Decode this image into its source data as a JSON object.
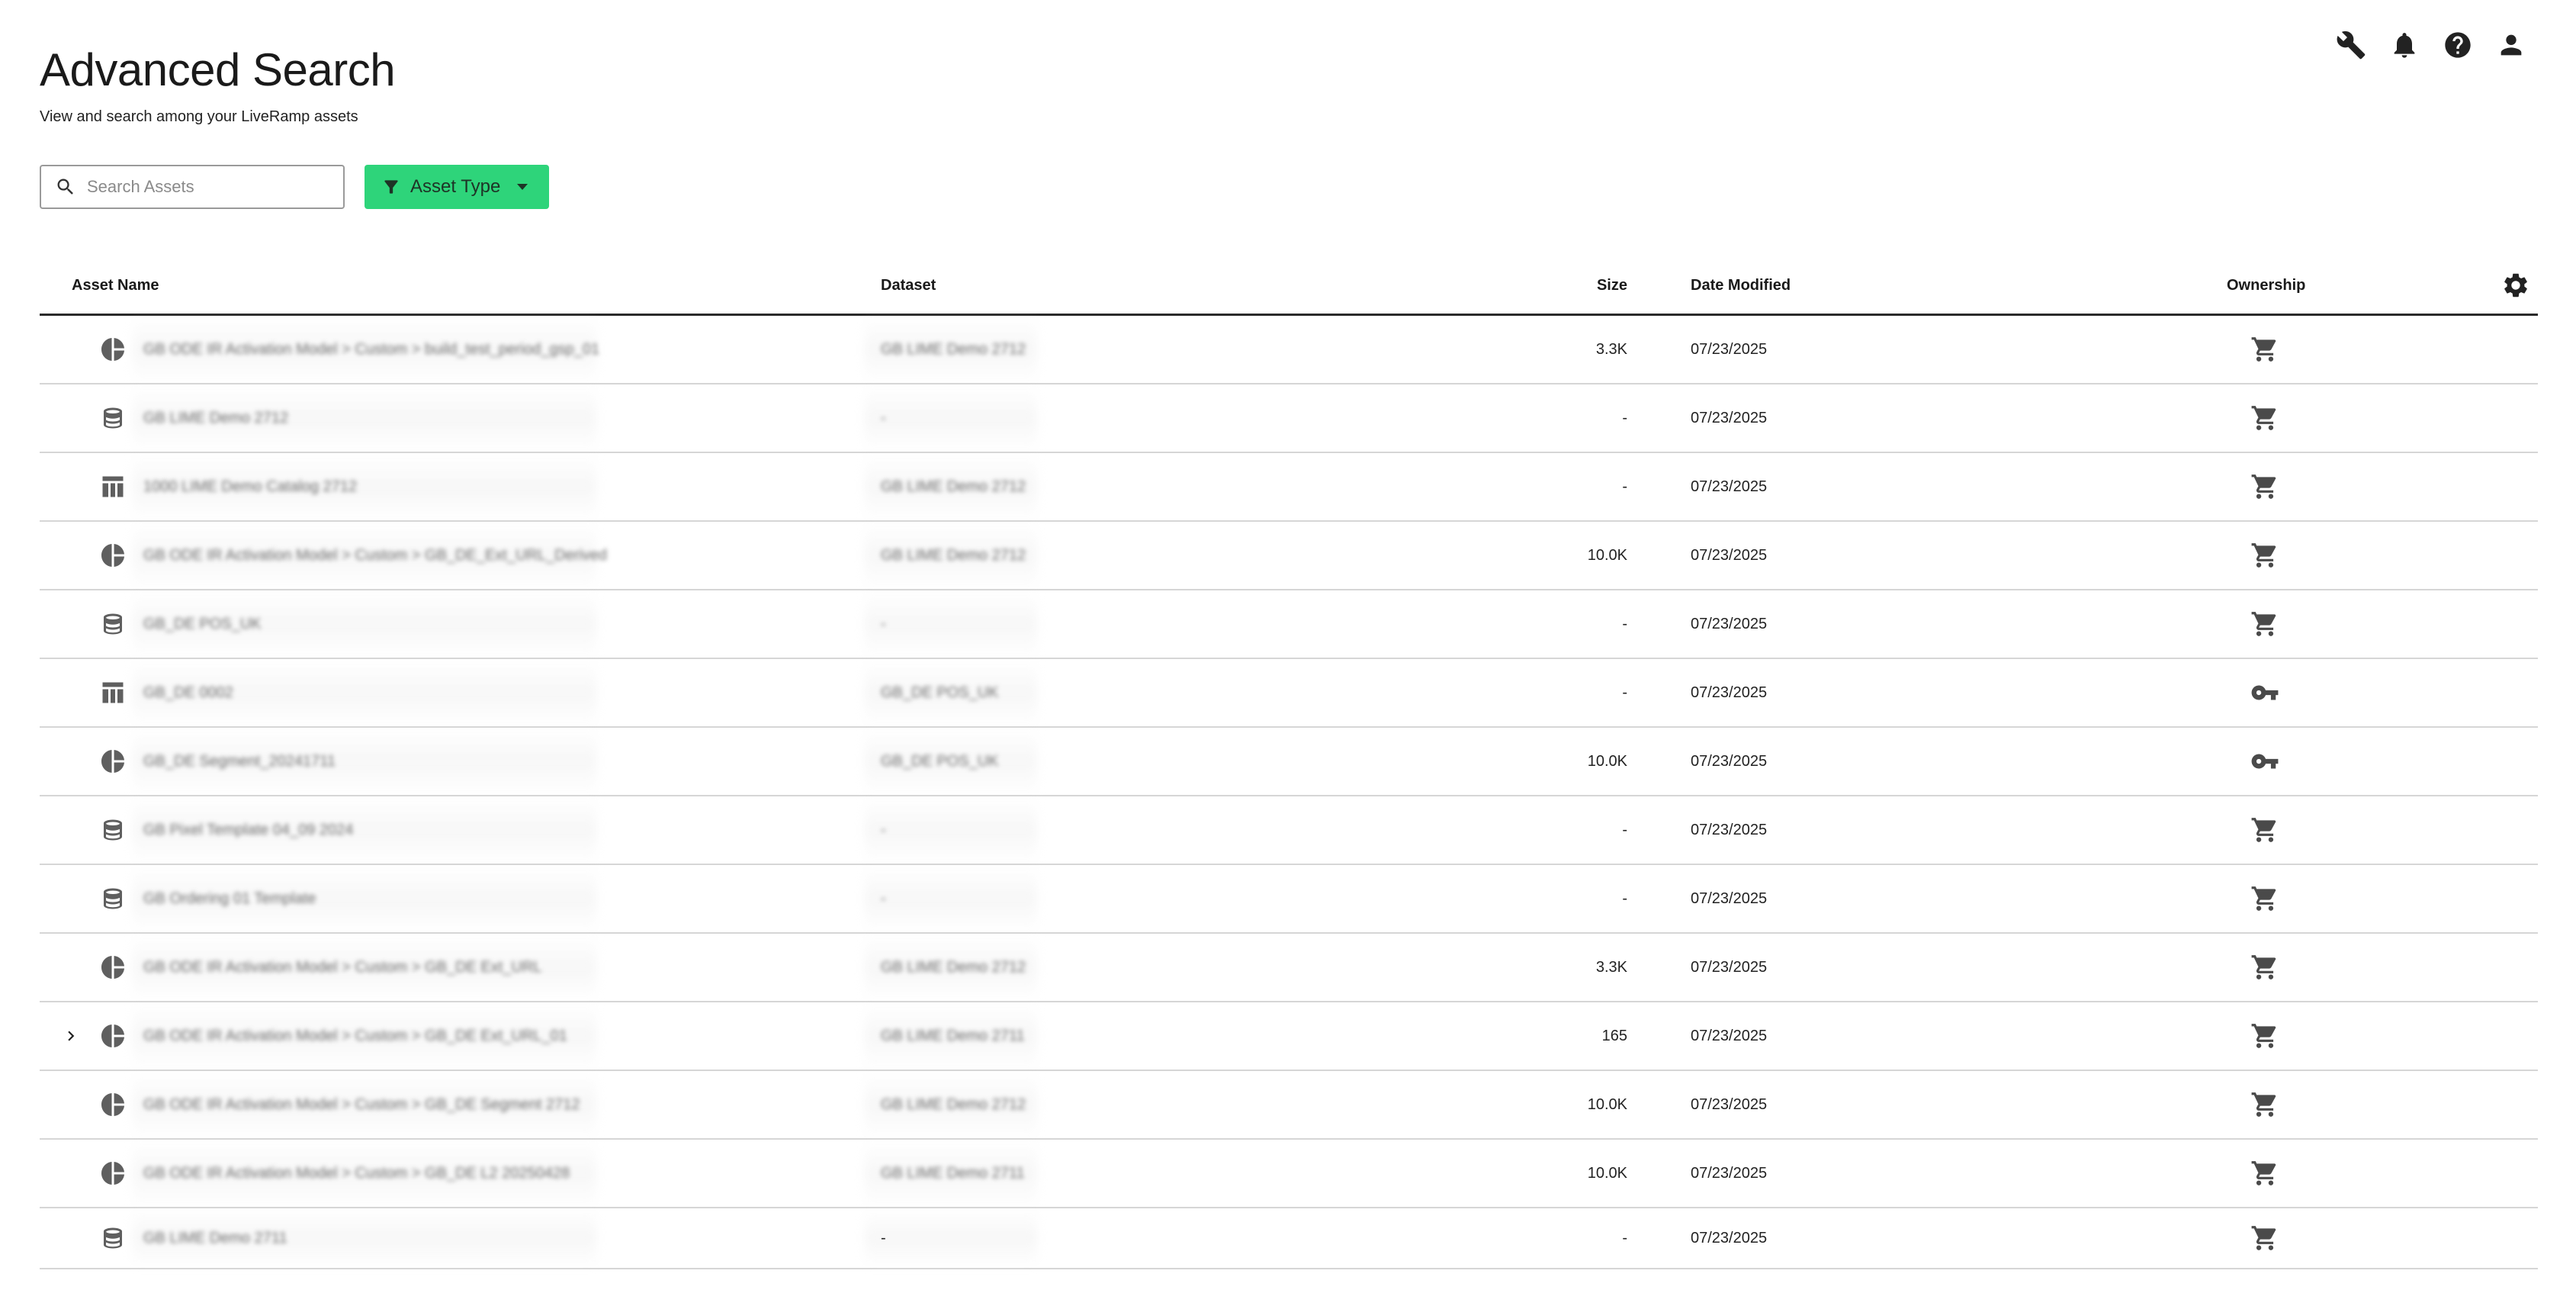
{
  "page": {
    "title": "Advanced Search",
    "subtitle": "View and search among your LiveRamp assets"
  },
  "topbar": {
    "icons": [
      "wrench-icon",
      "bell-icon",
      "help-icon",
      "user-icon"
    ]
  },
  "search": {
    "placeholder": "Search Assets",
    "value": ""
  },
  "filter": {
    "label": "Asset Type",
    "color": "#2ed47a"
  },
  "table": {
    "columns": {
      "name": "Asset Name",
      "dataset": "Dataset",
      "size": "Size",
      "date": "Date Modified",
      "ownership": "Ownership"
    },
    "rows": [
      {
        "type": "pie",
        "name": "GB ODE IR Activation Model > Custom > build_test_period_gsp_01",
        "dataset": "GB LIME Demo 2712",
        "size": "3.3K",
        "date": "07/23/2025",
        "ownership": "cart",
        "expandable": false,
        "blurDataset": true
      },
      {
        "type": "database",
        "name": "GB LIME Demo 2712",
        "dataset": "-",
        "size": "-",
        "date": "07/23/2025",
        "ownership": "cart",
        "expandable": false,
        "blurDataset": true
      },
      {
        "type": "table",
        "name": "1000 LIME Demo Catalog 2712",
        "dataset": "GB LIME Demo 2712",
        "size": "-",
        "date": "07/23/2025",
        "ownership": "cart",
        "expandable": false,
        "blurDataset": true
      },
      {
        "type": "pie",
        "name": "GB ODE IR Activation Model > Custom > GB_DE_Ext_URL_Derived",
        "dataset": "GB LIME Demo 2712",
        "size": "10.0K",
        "date": "07/23/2025",
        "ownership": "cart",
        "expandable": false,
        "blurDataset": true
      },
      {
        "type": "database",
        "name": "GB_DE POS_UK",
        "dataset": "-",
        "size": "-",
        "date": "07/23/2025",
        "ownership": "cart",
        "expandable": false,
        "blurDataset": true
      },
      {
        "type": "table",
        "name": "GB_DE 0002",
        "dataset": "GB_DE POS_UK",
        "size": "-",
        "date": "07/23/2025",
        "ownership": "key",
        "expandable": false,
        "blurDataset": true
      },
      {
        "type": "pie",
        "name": "GB_DE Segment_20241711",
        "dataset": "GB_DE POS_UK",
        "size": "10.0K",
        "date": "07/23/2025",
        "ownership": "key",
        "expandable": false,
        "blurDataset": true
      },
      {
        "type": "database",
        "name": "GB Pixel Template 04_09 2024",
        "dataset": "-",
        "size": "-",
        "date": "07/23/2025",
        "ownership": "cart",
        "expandable": false,
        "blurDataset": true
      },
      {
        "type": "database",
        "name": "GB Ordering 01 Template",
        "dataset": "-",
        "size": "-",
        "date": "07/23/2025",
        "ownership": "cart",
        "expandable": false,
        "blurDataset": true
      },
      {
        "type": "pie",
        "name": "GB ODE IR Activation Model > Custom > GB_DE Ext_URL",
        "dataset": "GB LIME Demo 2712",
        "size": "3.3K",
        "date": "07/23/2025",
        "ownership": "cart",
        "expandable": false,
        "blurDataset": true
      },
      {
        "type": "pie",
        "name": "GB ODE IR Activation Model > Custom > GB_DE Ext_URL_01",
        "dataset": "GB LIME Demo 2711",
        "size": "165",
        "date": "07/23/2025",
        "ownership": "cart",
        "expandable": true,
        "blurDataset": true
      },
      {
        "type": "pie",
        "name": "GB ODE IR Activation Model > Custom > GB_DE Segment 2712",
        "dataset": "GB LIME Demo 2712",
        "size": "10.0K",
        "date": "07/23/2025",
        "ownership": "cart",
        "expandable": false,
        "blurDataset": true
      },
      {
        "type": "pie",
        "name": "GB ODE IR Activation Model > Custom > GB_DE L2 20250428",
        "dataset": "GB LIME Demo 2711",
        "size": "10.0K",
        "date": "07/23/2025",
        "ownership": "cart",
        "expandable": false,
        "blurDataset": true
      },
      {
        "type": "database",
        "name": "GB LIME Demo 2711",
        "dataset": "-",
        "size": "-",
        "date": "07/23/2025",
        "ownership": "cart",
        "expandable": false,
        "blurDataset": false
      }
    ]
  }
}
